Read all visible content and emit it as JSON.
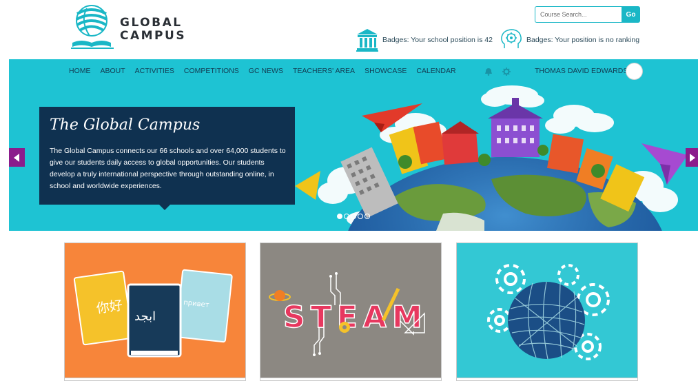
{
  "brand": {
    "logo_line1": "GLOBAL",
    "logo_line2": "CAMPUS",
    "logo_icon": "globe-book-logo"
  },
  "search": {
    "placeholder": "Course Search...",
    "button_label": "Go"
  },
  "badges": {
    "school": {
      "text": "Badges: Your school position is 42",
      "icon": "institution-icon"
    },
    "personal": {
      "text": "Badges: Your position is no ranking",
      "icon": "head-gear-icon"
    }
  },
  "nav": {
    "items": [
      {
        "label": "HOME"
      },
      {
        "label": "ABOUT"
      },
      {
        "label": "ACTIVITIES"
      },
      {
        "label": "COMPETITIONS"
      },
      {
        "label": "GC NEWS"
      },
      {
        "label": "TEACHERS' AREA"
      },
      {
        "label": "SHOWCASE"
      },
      {
        "label": "CALENDAR"
      }
    ],
    "icons": [
      "bell-icon",
      "gear-icon"
    ],
    "user_name": "THOMAS DAVID EDWARDS"
  },
  "hero": {
    "title": "The Global Campus",
    "body": "The Global Campus connects our 66 schools and over 64,000 students to give our students daily access to global opportunities. Our students develop a truly international perspective through outstanding online, in school and worldwide experiences.",
    "slide_count": 5,
    "active_slide": 1
  },
  "cards": [
    {
      "name": "languages-card",
      "text": [
        "你好",
        "ابجد",
        "привет"
      ]
    },
    {
      "name": "steam-card",
      "text": [
        "STEAM"
      ]
    },
    {
      "name": "global-gears-card",
      "text": []
    }
  ],
  "colors": {
    "accent": "#1ec3d3",
    "navy": "#0f3150",
    "purple": "#8b1c8c",
    "orange": "#f7853a",
    "grey": "#8c8882"
  }
}
